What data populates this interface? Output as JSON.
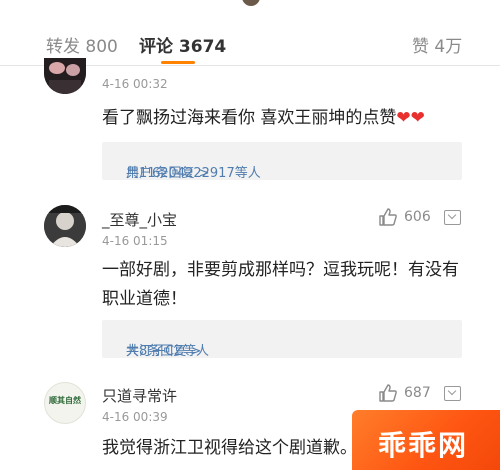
{
  "tabs": {
    "reposts": "转发 800",
    "comments": "评论 3674",
    "likes": "赞 4万"
  },
  "comments": [
    {
      "username": "",
      "time": "4-16 00:32",
      "text": "看了飘扬过海来看你 喜欢王丽坤的点赞❤❤",
      "reply_users": "用户6204222917等人",
      "reply_count": "共11条回复 >"
    },
    {
      "username": "_至尊_小宝",
      "time": "4-16 01:15",
      "text": "一部好剧，非要剪成那样吗？逗我玩呢！有没有职业道德！",
      "like_count": "606",
      "reply_users": "大汀子CZ等人",
      "reply_count": "共8条回复 >"
    },
    {
      "username": "只道寻常许",
      "time": "4-16 00:39",
      "text": "我觉得浙江卫视得给这个剧道歉。",
      "like_count": "687",
      "avatar_text": "顺其自然"
    }
  ],
  "watermark": "乖乖网",
  "colors": {
    "accent": "#ff8200",
    "link": "#507daf",
    "heart": "#e8312f"
  },
  "icons": [
    "thumbs-up-icon",
    "more-icon",
    "heart-icon"
  ]
}
